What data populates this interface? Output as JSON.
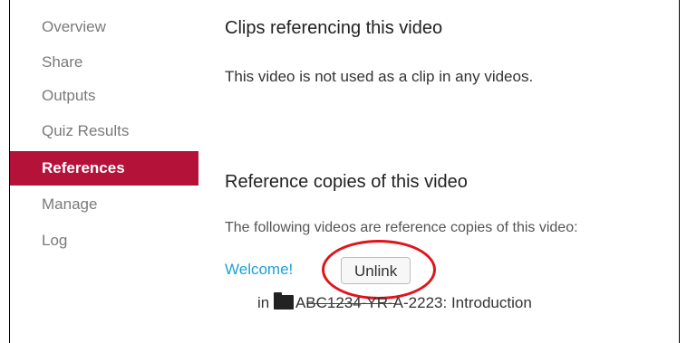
{
  "sidebar": {
    "items": [
      {
        "label": "Overview"
      },
      {
        "label": "Share"
      },
      {
        "label": "Outputs"
      },
      {
        "label": "Quiz Results"
      },
      {
        "label": "References",
        "active": true
      },
      {
        "label": "Manage"
      },
      {
        "label": "Log"
      }
    ]
  },
  "clips": {
    "heading": "Clips referencing this video",
    "empty_text": "This video is not used as a clip in any videos."
  },
  "refcopies": {
    "heading": "Reference copies of this video",
    "intro": "The following videos are reference copies of this video:",
    "item": {
      "title": "Welcome!",
      "unlink_label": "Unlink",
      "in_label": "in",
      "folder_icon": "folder-icon",
      "folder_name": "ABC1234-YR-A-2223: Introduction"
    }
  },
  "colors": {
    "active_nav": "#b5123a",
    "link": "#1ea0d6",
    "highlight_circle": "#e0151c"
  }
}
